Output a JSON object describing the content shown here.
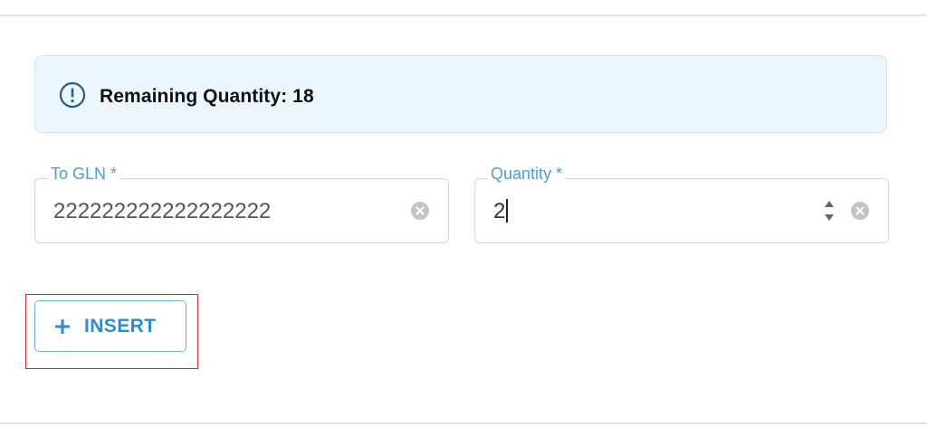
{
  "info_banner": {
    "icon": "info-icon",
    "text": "Remaining Quantity: 18",
    "background": "#eef6fd",
    "border": "#cfe3f5"
  },
  "form": {
    "to_gln": {
      "label": "To GLN *",
      "value": "222222222222222222",
      "clear_icon": "clear-circle-icon"
    },
    "quantity": {
      "label": "Quantity *",
      "value": "2",
      "spinner_icon": "spinner-arrows-icon",
      "clear_icon": "clear-circle-icon"
    }
  },
  "actions": {
    "insert_icon": "plus-icon",
    "insert_label": "INSERT"
  },
  "colors": {
    "accent": "#2f8ad0",
    "label": "#4a9fd6",
    "highlight": "#d9262c",
    "divider": "#e6e6e6"
  }
}
